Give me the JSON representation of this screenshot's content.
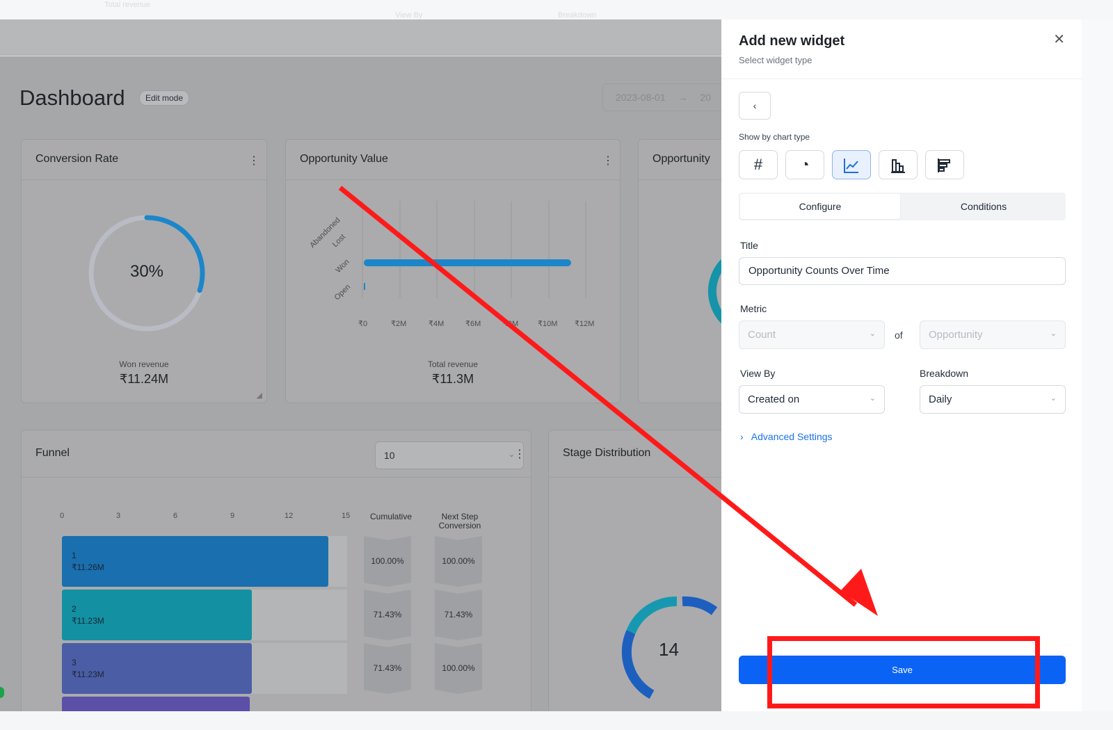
{
  "background": {
    "ghost_left": "Total revenue",
    "ghost_view_by": "View By",
    "ghost_breakdown": "Breakdown"
  },
  "dashboard": {
    "title": "Dashboard",
    "edit_mode": "Edit mode",
    "date_start": "2023-08-01",
    "date_arrow": "→",
    "date_end": "20",
    "conversion": {
      "title": "Conversion Rate",
      "percent_text": "30%",
      "percent": 0.3,
      "sub_label": "Won revenue",
      "value": "₹11.24M"
    },
    "opportunity_value": {
      "title": "Opportunity Value",
      "categories": [
        "Abandoned",
        "Lost",
        "Won",
        "Open"
      ],
      "ticks": [
        "₹0",
        "₹2M",
        "₹4M",
        "₹6M",
        "₹8M",
        "₹10M",
        "₹12M"
      ],
      "sub_label": "Total revenue",
      "value": "₹11.3M"
    },
    "opportunity_partial": {
      "title": "Opportunity"
    },
    "funnel": {
      "title": "Funnel",
      "select_value": "10",
      "ticks": [
        "0",
        "3",
        "6",
        "9",
        "12",
        "15"
      ],
      "col_cumulative": "Cumulative",
      "col_next_step_1": "Next Step",
      "col_next_step_2": "Conversion",
      "rows": [
        {
          "stage": "1",
          "amount": "₹11.26M",
          "count": 14,
          "cumulative": "100.00%",
          "next": "100.00%",
          "color": "#1a6fae"
        },
        {
          "stage": "2",
          "amount": "₹11.23M",
          "count": 10,
          "cumulative": "71.43%",
          "next": "71.43%",
          "color": "#1390a1"
        },
        {
          "stage": "3",
          "amount": "₹11.23M",
          "count": 10,
          "cumulative": "71.43%",
          "next": "100.00%",
          "color": "#4b5da5"
        }
      ]
    },
    "stage_distribution": {
      "title": "Stage Distribution",
      "total": "14"
    }
  },
  "modal": {
    "title": "Add new widget",
    "subtitle": "Select widget type",
    "close_glyph": "✕",
    "back_glyph": "‹",
    "show_by_label": "Show by chart type",
    "chart_types": [
      {
        "name": "number",
        "glyph": "#",
        "active": false
      },
      {
        "name": "pie",
        "glyph": "◔",
        "active": false
      },
      {
        "name": "line",
        "glyph": "line",
        "active": true
      },
      {
        "name": "bar",
        "glyph": "bar",
        "active": false
      },
      {
        "name": "horizontal-bar",
        "glyph": "hbar",
        "active": false
      }
    ],
    "tabs": {
      "configure": "Configure",
      "conditions": "Conditions"
    },
    "title_label": "Title",
    "title_value": "Opportunity Counts Over Time",
    "metric_label": "Metric",
    "metric_value": "Count",
    "of_label": "of",
    "metric_entity": "Opportunity",
    "view_by_label": "View By",
    "view_by_value": "Created on",
    "breakdown_label": "Breakdown",
    "breakdown_value": "Daily",
    "advanced": "Advanced Settings",
    "save": "Save"
  },
  "colors": {
    "primary": "#0b63f6",
    "annotation": "#ff1a1a",
    "active_chart": "#1f6fe0"
  }
}
